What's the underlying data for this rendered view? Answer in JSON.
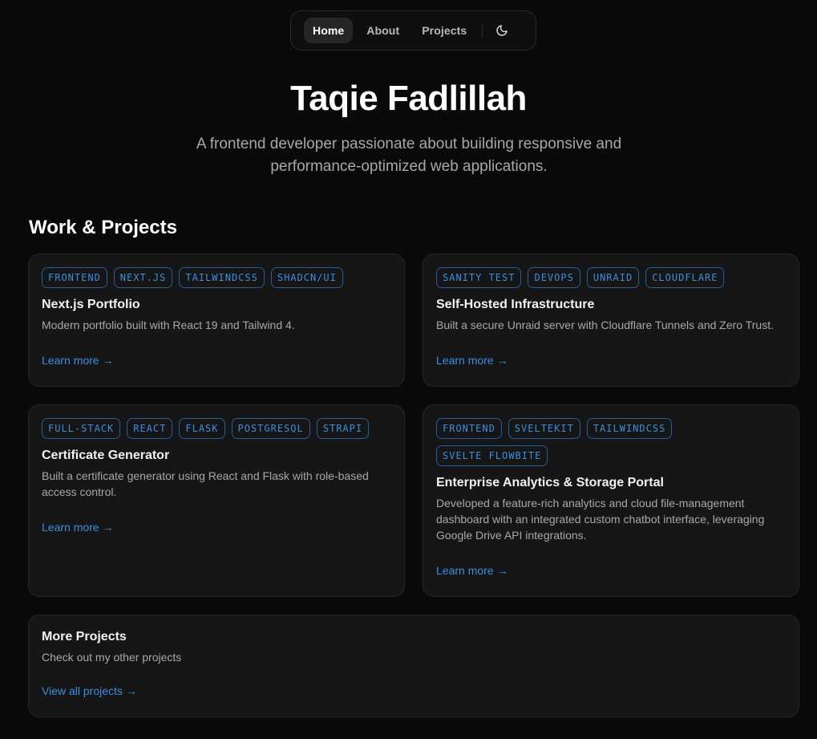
{
  "nav": {
    "items": [
      {
        "label": "Home",
        "active": true
      },
      {
        "label": "About",
        "active": false
      },
      {
        "label": "Projects",
        "active": false
      }
    ],
    "theme_icon": "moon-icon"
  },
  "hero": {
    "title": "Taqie Fadlillah",
    "subtitle": "A frontend developer passionate about building responsive and performance-optimized web applications."
  },
  "projects_section": {
    "title": "Work & Projects",
    "cards": [
      {
        "tags": [
          "FRONTEND",
          "NEXT.JS",
          "TAILWINDCSS",
          "SHADCN/UI"
        ],
        "title": "Next.js Portfolio",
        "description": "Modern portfolio built with React 19 and Tailwind 4.",
        "link": "Learn more"
      },
      {
        "tags": [
          "SANITY TEST",
          "DEVOPS",
          "UNRAID",
          "CLOUDFLARE"
        ],
        "title": "Self-Hosted Infrastructure",
        "description": "Built a secure Unraid server with Cloudflare Tunnels and Zero Trust.",
        "link": "Learn more"
      },
      {
        "tags": [
          "FULL-STACK",
          "REACT",
          "FLASK",
          "POSTGRESQL",
          "STRAPI"
        ],
        "title": "Certificate Generator",
        "description": "Built a certificate generator using React and Flask with role-based access control.",
        "link": "Learn more"
      },
      {
        "tags": [
          "FRONTEND",
          "SVELTEKIT",
          "TAILWINDCSS",
          "SVELTE FLOWBITE"
        ],
        "title": "Enterprise Analytics & Storage Portal",
        "description": "Developed a feature-rich analytics and cloud file-management dashboard with an integrated custom chatbot interface, leveraging Google Drive API integrations.",
        "link": "Learn more"
      }
    ],
    "more": {
      "title": "More Projects",
      "description": "Check out my other projects",
      "link": "View all projects"
    },
    "arrow": "→"
  },
  "colors": {
    "background": "#0a0a0a",
    "card": "#161616",
    "accent": "#3b8fe0"
  }
}
